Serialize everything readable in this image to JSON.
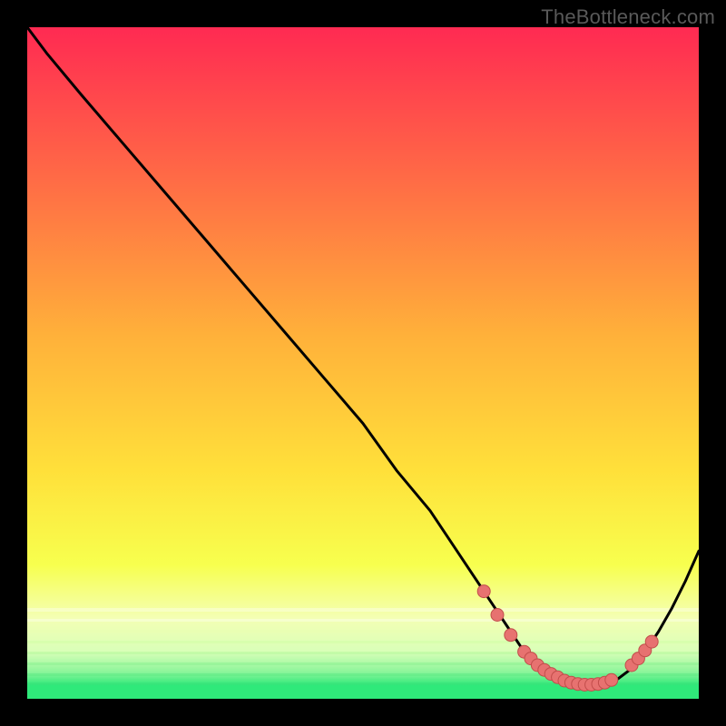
{
  "watermark": "TheBottleneck.com",
  "colors": {
    "black": "#000000",
    "curve_stroke": "#000000",
    "marker_fill": "#e77270",
    "marker_stroke": "#c24d4b",
    "grad_top": "#ff2a52",
    "grad_mid1": "#ff8a3d",
    "grad_mid2": "#ffe03a",
    "grad_mid3": "#f6ff55",
    "grad_pale": "#f4ffcf",
    "grad_green": "#2fe97a"
  },
  "chart_data": {
    "type": "line",
    "title": "",
    "xlabel": "",
    "ylabel": "",
    "xlim": [
      0,
      100
    ],
    "ylim": [
      0,
      100
    ],
    "series": [
      {
        "name": "bottleneck-curve",
        "x": [
          0,
          3,
          8,
          14,
          20,
          26,
          32,
          38,
          44,
          50,
          55,
          60,
          64,
          68,
          70,
          72,
          74,
          76,
          78,
          80,
          82,
          84,
          86,
          88,
          90,
          92,
          94,
          96,
          98,
          100
        ],
        "y": [
          100,
          96,
          90,
          83,
          76,
          69,
          62,
          55,
          48,
          41,
          34,
          28,
          22,
          16,
          13,
          10,
          7,
          5,
          3.5,
          2.5,
          2,
          2,
          2.2,
          3,
          4.5,
          7,
          10,
          13.5,
          17.5,
          22
        ]
      }
    ],
    "markers": {
      "name": "highlighted-points",
      "x": [
        68,
        70,
        72,
        74,
        75,
        76,
        77,
        78,
        79,
        80,
        81,
        82,
        83,
        84,
        85,
        86,
        87,
        90,
        91,
        92,
        93
      ],
      "y": [
        16,
        12.5,
        9.5,
        7,
        6,
        5,
        4.3,
        3.7,
        3.2,
        2.7,
        2.4,
        2.2,
        2.1,
        2.1,
        2.2,
        2.4,
        2.8,
        5,
        6,
        7.2,
        8.5
      ]
    }
  }
}
